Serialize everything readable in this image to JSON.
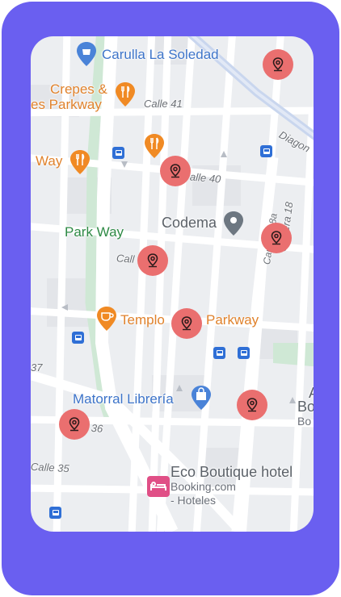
{
  "colors": {
    "frame": "#6a5ff0",
    "marker": "#ea6f6f",
    "poi_blue": "#3d74c9",
    "poi_orange": "#e0822c",
    "park_text": "#2e8a45",
    "bus_stop": "#2f6fd6"
  },
  "labels": {
    "carulla": "Carulla La Soledad",
    "crepes_line1": "Crepes &",
    "crepes_line2": "es Parkway",
    "calle41": "Calle 41",
    "way": "Way",
    "calle40": "alle 40",
    "codema": "Codema",
    "park_way": "Park Way",
    "call": "Call",
    "carrera18": "Carrera 18",
    "carrera18a": "Carrera 18a",
    "templo": "Templo",
    "parkway": "Parkway",
    "matorral": "Matorral Librería",
    "e36": "e 36",
    "calle35": "Calle 35",
    "eco_boutique": "Eco Boutique hotel",
    "booking": "Booking.com",
    "hoteles": "- Hoteles",
    "diagon": "Diagon",
    "num37": "37",
    "bo1": "Bo",
    "bo2": "Bo",
    "a": "A"
  },
  "icons": {
    "marker": "location-pin-icon",
    "bus": "bus-stop-icon",
    "food": "restaurant-icon",
    "cafe": "cafe-icon",
    "shop": "shopping-bag-icon",
    "hotel": "hotel-bed-icon",
    "place": "place-pin-icon"
  },
  "markers": [
    "marker-1",
    "marker-2",
    "marker-3",
    "marker-4",
    "marker-5",
    "marker-6",
    "marker-7"
  ]
}
